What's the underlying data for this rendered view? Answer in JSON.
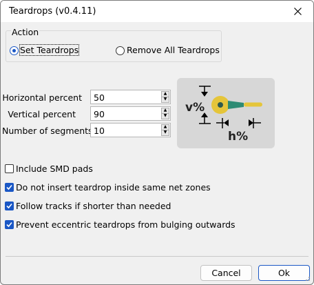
{
  "window": {
    "title": "Teardrops (v0.4.11)"
  },
  "action": {
    "label": "Action",
    "set_teardrops": "Set Teardrops",
    "remove_all": "Remove All Teardrops",
    "selected": "set_teardrops"
  },
  "fields": {
    "horizontal": {
      "label": "Horizontal percent",
      "value": "50"
    },
    "vertical": {
      "label": "Vertical percent",
      "value": "90"
    },
    "segments": {
      "label": "Number of segments",
      "value": "10"
    }
  },
  "diagram": {
    "v_label": "v%",
    "h_label": "h%",
    "colors": {
      "pad": "#e5c53a",
      "teardrop": "#2e8b74",
      "track": "#e5c53a"
    }
  },
  "options": {
    "include_smd": {
      "label": "Include SMD pads",
      "checked": false
    },
    "no_same_net": {
      "label": "Do not insert teardrop inside same net zones",
      "checked": true
    },
    "follow_tracks": {
      "label": "Follow tracks if shorter than needed",
      "checked": true
    },
    "prevent_eccentric": {
      "label": "Prevent eccentric teardrops from bulging outwards",
      "checked": true
    }
  },
  "buttons": {
    "cancel": "Cancel",
    "ok": "Ok"
  },
  "accent": "#1a57c5",
  "icons": [
    "close-icon",
    "up-arrow-icon",
    "down-arrow-icon",
    "checkmark-icon",
    "resize-grip-icon"
  ]
}
